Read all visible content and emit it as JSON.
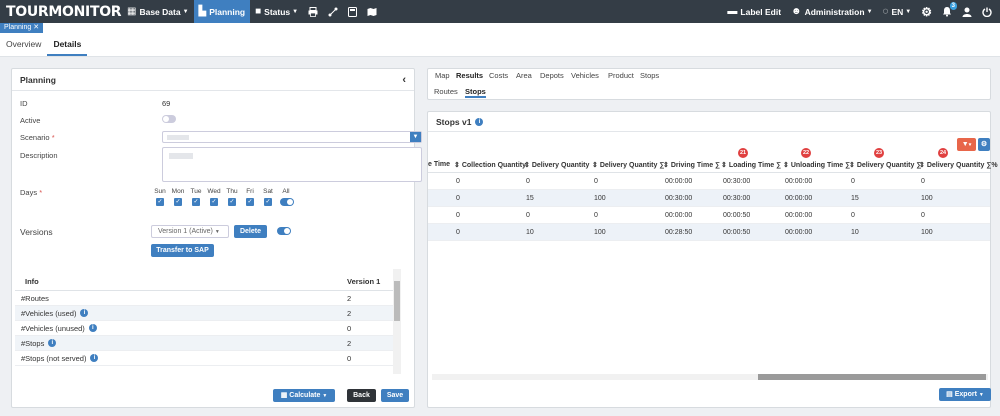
{
  "app": {
    "logo": "TOURMONITOR",
    "nav": [
      {
        "label": "Base Data",
        "icon": "database-icon",
        "glyph": "▦"
      },
      {
        "label": "Planning",
        "icon": "chart-icon",
        "glyph": "▙",
        "active": true
      },
      {
        "label": "Status",
        "icon": "video-icon",
        "glyph": "■"
      }
    ],
    "nav_icons": [
      "print-icon",
      "route-icon",
      "calculator-icon",
      "map-icon"
    ],
    "right_nav": {
      "label_edit": "Label Edit",
      "administration": "Administration",
      "language": "EN",
      "notifications_count": "3"
    }
  },
  "tabs": {
    "open_tab": "Planning ✕",
    "sub": [
      "Overview",
      "Details"
    ],
    "active_sub": "Details"
  },
  "planning": {
    "title": "Planning",
    "id_label": "ID",
    "id_value": "69",
    "active_label": "Active",
    "scenario_label": "Scenario",
    "required_mark": "*",
    "description_label": "Description",
    "days_label": "Days",
    "days": [
      "Sun",
      "Mon",
      "Tue",
      "Wed",
      "Thu",
      "Fri",
      "Sat",
      "All"
    ],
    "versions_label": "Versions",
    "version_select": "Version 1 (Active)",
    "delete_label": "Delete",
    "transfer_label": "Transfer to SAP",
    "info_table": {
      "header_info": "Info",
      "header_version": "Version 1",
      "rows": [
        {
          "label": "#Routes",
          "value": "2",
          "info": false
        },
        {
          "label": "#Vehicles (used)",
          "value": "2",
          "info": true
        },
        {
          "label": "#Vehicles (unused)",
          "value": "0",
          "info": true
        },
        {
          "label": "#Stops",
          "value": "2",
          "info": true
        },
        {
          "label": "#Stops (not served)",
          "value": "0",
          "info": true
        }
      ]
    },
    "calculate_label": "Calculate",
    "back_label": "Back",
    "save_label": "Save"
  },
  "results": {
    "tabs": [
      "Map",
      "Results",
      "Costs",
      "Area",
      "Depots",
      "Vehicles",
      "Product",
      "Stops"
    ],
    "active_tab": "Results",
    "subtabs": [
      "Routes",
      "Stops"
    ],
    "active_subtab": "Stops",
    "panel_title": "Stops v1",
    "columns": [
      "e Time",
      "Collection Quantity",
      "Delivery Quantity",
      "Delivery Quantity ∑",
      "Driving Time ∑",
      "Loading Time ∑",
      "Unloading Time ∑",
      "Delivery Quantity ∑",
      "Delivery Quantity ∑%"
    ],
    "markers": [
      "21",
      "22",
      "23",
      "24"
    ],
    "rows": [
      [
        "0",
        "0",
        "0",
        "00:00:00",
        "00:30:00",
        "00:00:00",
        "0",
        "0"
      ],
      [
        "0",
        "15",
        "100",
        "00:30:00",
        "00:30:00",
        "00:00:00",
        "15",
        "100"
      ],
      [
        "0",
        "0",
        "0",
        "00:00:00",
        "00:00:50",
        "00:00:00",
        "0",
        "0"
      ],
      [
        "0",
        "10",
        "100",
        "00:28:50",
        "00:00:50",
        "00:00:00",
        "10",
        "100"
      ]
    ],
    "export_label": "Export"
  },
  "colors": {
    "nav_bg": "#343d46",
    "accent": "#3f7fc0",
    "marker": "#e04040",
    "back_button": "#2f3338",
    "filter_button": "#e8664a"
  }
}
